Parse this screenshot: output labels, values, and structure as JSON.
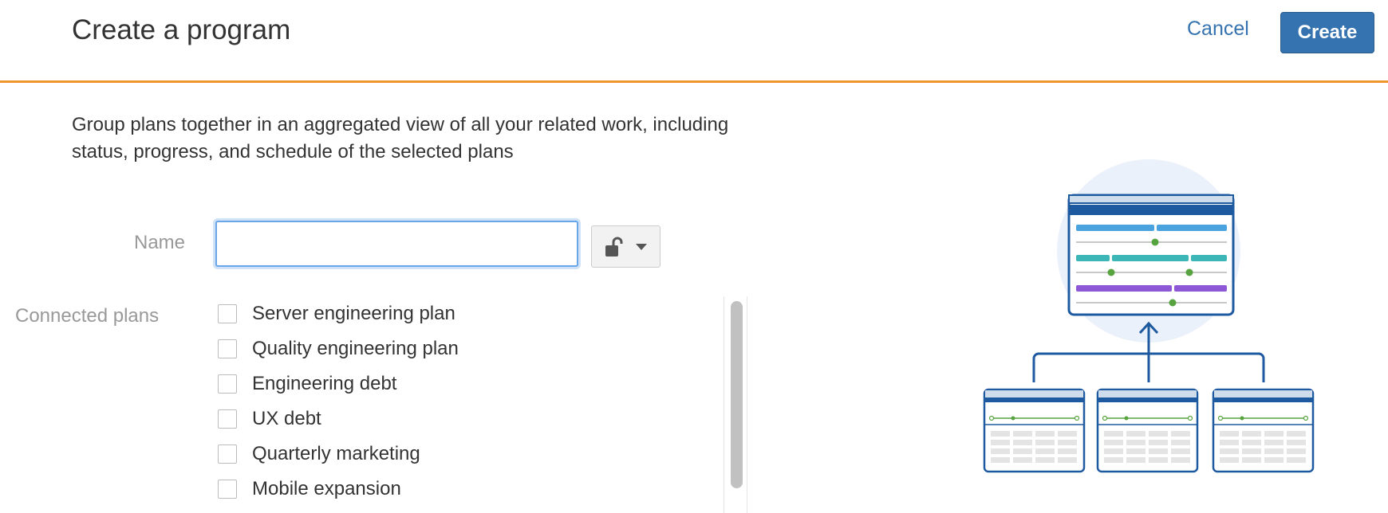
{
  "header": {
    "title": "Create a program",
    "cancel_label": "Cancel",
    "create_label": "Create"
  },
  "description": "Group plans together in an aggregated view of all your related work, including status, progress, and schedule of the selected plans",
  "form": {
    "name_label": "Name",
    "name_value": "",
    "name_placeholder": "",
    "connected_plans_label": "Connected plans",
    "plans": [
      {
        "label": "Server engineering plan",
        "checked": false
      },
      {
        "label": "Quality engineering plan",
        "checked": false
      },
      {
        "label": "Engineering debt",
        "checked": false
      },
      {
        "label": "UX debt",
        "checked": false
      },
      {
        "label": "Quarterly marketing",
        "checked": false
      },
      {
        "label": "Mobile expansion",
        "checked": false
      }
    ]
  },
  "colors": {
    "accent": "#3572b0",
    "header_border": "#f0952d",
    "illustration_blue": "#1e5aa0",
    "bar_light_blue": "#4aa3df",
    "bar_teal": "#3cb6b6",
    "bar_purple": "#8e57d6",
    "dot_green": "#57a33f"
  },
  "icons": {
    "lock": "unlock-icon",
    "dropdown": "chevron-down-icon"
  }
}
